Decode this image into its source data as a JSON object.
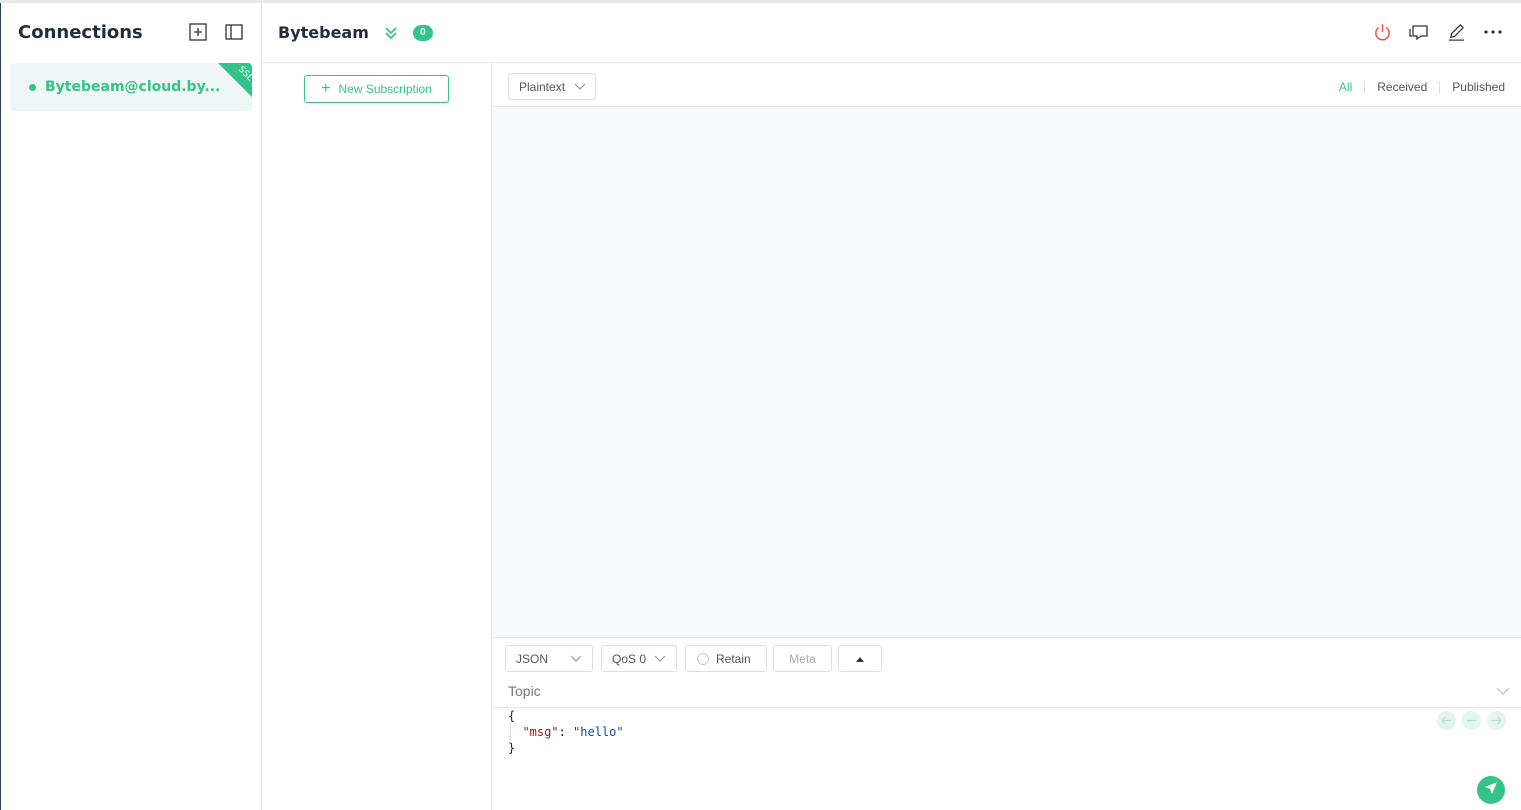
{
  "sidebar": {
    "title": "Connections",
    "connections": [
      {
        "name": "Bytebeam@cloud.by...",
        "badge": "SSL",
        "status_color": "#34c388"
      }
    ]
  },
  "header": {
    "title": "Bytebeam",
    "message_count": "0",
    "actions": [
      "power-icon",
      "chat-icon",
      "edit-icon",
      "more-icon"
    ]
  },
  "subscriptions": {
    "new_label": "New Subscription"
  },
  "messages": {
    "format": "Plaintext",
    "filters": {
      "all": "All",
      "received": "Received",
      "published": "Published"
    }
  },
  "publish": {
    "payload_type": "JSON",
    "qos": "QoS 0",
    "retain_label": "Retain",
    "meta_label": "Meta",
    "topic_placeholder": "Topic",
    "payload_lines": [
      "{",
      "\"msg\": \"hello\"",
      "}"
    ]
  },
  "colors": {
    "accent": "#34c388",
    "power": "#e74c3c"
  }
}
